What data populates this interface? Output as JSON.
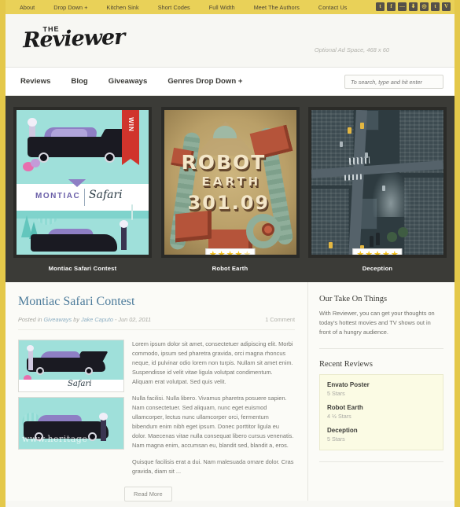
{
  "topbar": {
    "links": [
      {
        "label": "About"
      },
      {
        "label": "Drop Down +"
      },
      {
        "label": "Kitchen Sink"
      },
      {
        "label": "Short Codes"
      },
      {
        "label": "Full Width"
      },
      {
        "label": "Meet The Authors"
      },
      {
        "label": "Contact Us"
      }
    ],
    "social": [
      {
        "name": "twitter-icon",
        "glyph": "t"
      },
      {
        "name": "facebook-icon",
        "glyph": "f"
      },
      {
        "name": "flickr-icon",
        "glyph": "—"
      },
      {
        "name": "rss-icon",
        "glyph": "⬇"
      },
      {
        "name": "instagram-icon",
        "glyph": "◎"
      },
      {
        "name": "tumblr-icon",
        "glyph": "t"
      },
      {
        "name": "vimeo-icon",
        "glyph": "V"
      }
    ]
  },
  "masthead": {
    "logo_the": "THE",
    "logo_name": "Reviewer",
    "ad_text": "Optional Ad Space, 468 x 60"
  },
  "mainnav": {
    "links": [
      {
        "label": "Reviews"
      },
      {
        "label": "Blog"
      },
      {
        "label": "Giveaways"
      },
      {
        "label": "Genres Drop Down +"
      }
    ],
    "search_placeholder": "To search, type and hit enter",
    "search_value": ""
  },
  "featured": {
    "items": [
      {
        "title": "Montiac Safari Contest",
        "rating": null,
        "ribbon": "WIN",
        "poster_brand_left": "MONTIAC",
        "poster_brand_right": "Safari"
      },
      {
        "title": "Robot Earth",
        "rating": 4.5,
        "poster_line1": "ROBOT",
        "poster_line2": "EARTH",
        "poster_line3": "301.09"
      },
      {
        "title": "Deception",
        "rating": 5
      }
    ]
  },
  "post": {
    "title": "Montiac Safari Contest",
    "meta_prefix": "Posted in",
    "meta_category": "Giveaways",
    "meta_by": "by",
    "meta_author": "Jake Caputo",
    "meta_sep": "-",
    "meta_date": "Jun 02, 2011",
    "comments": "1 Comment",
    "paragraphs": [
      "Lorem ipsum dolor sit amet, consectetuer adipiscing elit. Morbi commodo, ipsum sed pharetra gravida, orci magna rhoncus neque, id pulvinar odio lorem non turpis. Nullam sit amet enim. Suspendisse id velit vitae ligula volutpat condimentum. Aliquam erat volutpat. Sed quis velit.",
      "Nulla facilisi. Nulla libero. Vivamus pharetra posuere sapien. Nam consectetuer. Sed aliquam, nunc eget euismod ullamcorper, lectus nunc ullamcorper orci, fermentum bibendum enim nibh eget ipsum. Donec porttitor ligula eu dolor. Maecenas vitae nulla consequat libero cursus venenatis. Nam magna enim, accumsan eu, blandit sed, blandit a, eros.",
      "Quisque facilisis erat a dui. Nam malesuada ornare dolor. Cras gravida, diam sit ..."
    ],
    "read_more": "Read More",
    "thumb_watermark": "www.heritage"
  },
  "sidebar": {
    "about_title": "Our Take On Things",
    "about_text": "With Reviewer, you can get your thoughts on today's hottest movies and TV shows out in front of a hungry audience.",
    "recent_title": "Recent Reviews",
    "recent": [
      {
        "name": "Envato Poster",
        "stars": "5 Stars"
      },
      {
        "name": "Robot Earth",
        "stars": "4 ½ Stars"
      },
      {
        "name": "Deception",
        "stars": "5 Stars"
      }
    ]
  },
  "colors": {
    "frame": "#e4c84a",
    "topbar": "#e9d158",
    "featured_bg": "#3b3b37",
    "link": "#4f7d9c",
    "star": "#f2c01e",
    "review_box": "#fbfbe4"
  }
}
